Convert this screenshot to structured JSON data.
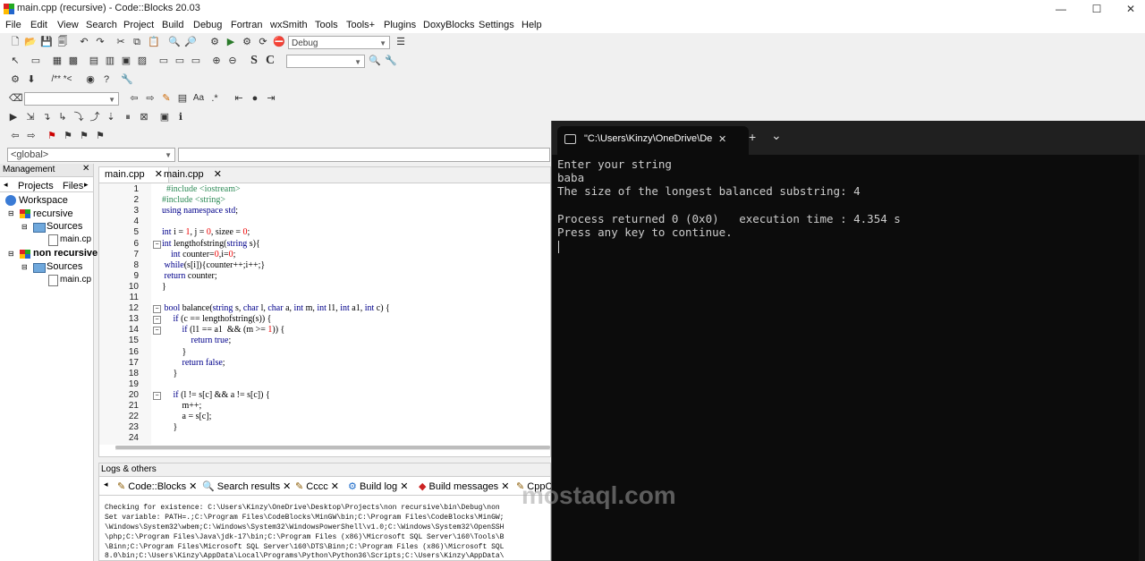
{
  "window": {
    "title": "main.cpp (recursive) - Code::Blocks 20.03",
    "min": "—",
    "max": "☐",
    "close": "✕"
  },
  "menu": [
    "File",
    "Edit",
    "View",
    "Search",
    "Project",
    "Build",
    "Debug",
    "Fortran",
    "wxSmith",
    "Tools",
    "Tools+",
    "Plugins",
    "DoxyBlocks",
    "Settings",
    "Help"
  ],
  "toolbar": {
    "build_target": "Debug",
    "text_s": "S",
    "text_c": "C",
    "regex_label": "/** *<"
  },
  "scope": {
    "value": "<global>"
  },
  "management": {
    "title": "Management",
    "tabs": [
      "Projects",
      "Files"
    ],
    "tree": [
      {
        "label": "Workspace"
      },
      {
        "label": "recursive"
      },
      {
        "label": "Sources"
      },
      {
        "label": "main.cp"
      },
      {
        "label": "non recursive"
      },
      {
        "label": "Sources"
      },
      {
        "label": "main.cp"
      }
    ]
  },
  "editor": {
    "tabs": [
      "main.cpp",
      "main.cpp"
    ],
    "line_numbers": [
      "1",
      "2",
      "3",
      "4",
      "5",
      "6",
      "7",
      "8",
      "9",
      "10",
      "11",
      "12",
      "13",
      "14",
      "15",
      "16",
      "17",
      "18",
      "19",
      "20",
      "21",
      "22",
      "23",
      "24"
    ],
    "lines": [
      "  #include <iostream>",
      "#include <string>",
      "using namespace std;",
      "",
      "int i = 1, j = 0, sizee = 0;",
      "int lengthofstring(string s){",
      "    int counter=0,i=0;",
      " while(s[i]){counter++;i++;}",
      " return counter;",
      "}",
      "",
      " bool balance(string s, char l, char a, int m, int l1, int a1, int c) {",
      "     if (c == lengthofstring(s)) {",
      "         if (l1 == a1  && (m >= 1)) {",
      "             return true;",
      "         }",
      "         return false;",
      "     }",
      "",
      "     if (l != s[c] && a != s[c]) {",
      "         m++;",
      "         a = s[c];",
      "     }",
      ""
    ]
  },
  "logs": {
    "title": "Logs & others",
    "tabs": [
      "Code::Blocks",
      "Search results",
      "Cccc",
      "Build log",
      "Build messages",
      "CppC"
    ],
    "lines": [
      "Checking for existence: C:\\Users\\Kinzy\\OneDrive\\Desktop\\Projects\\non recursive\\bin\\Debug\\non",
      "Set variable: PATH=.;C:\\Program Files\\CodeBlocks\\MinGW\\bin;C:\\Program Files\\CodeBlocks\\MinGW;",
      "\\Windows\\System32\\wbem;C:\\Windows\\System32\\WindowsPowerShell\\v1.0;C:\\Windows\\System32\\OpenSSH",
      "\\php;C:\\Program Files\\Java\\jdk-17\\bin;C:\\Program Files (x86)\\Microsoft SQL Server\\160\\Tools\\B",
      "\\Binn;C:\\Program Files\\Microsoft SQL Server\\160\\DTS\\Binn;C:\\Program Files (x86)\\Microsoft SQL",
      "8.0\\bin;C:\\Users\\Kinzy\\AppData\\Local\\Programs\\Python\\Python36\\Scripts;C:\\Users\\Kinzy\\AppData\\"
    ]
  },
  "terminal": {
    "tab_title": "\"C:\\Users\\Kinzy\\OneDrive\\De",
    "tab_close": "✕",
    "new_tab": "+",
    "dropdown": "⌄",
    "lines": [
      "Enter your string",
      "baba",
      "The size of the longest balanced substring: 4",
      "",
      "Process returned 0 (0x0)   execution time : 4.354 s",
      "Press any key to continue."
    ]
  },
  "watermark": "mostaql.com"
}
